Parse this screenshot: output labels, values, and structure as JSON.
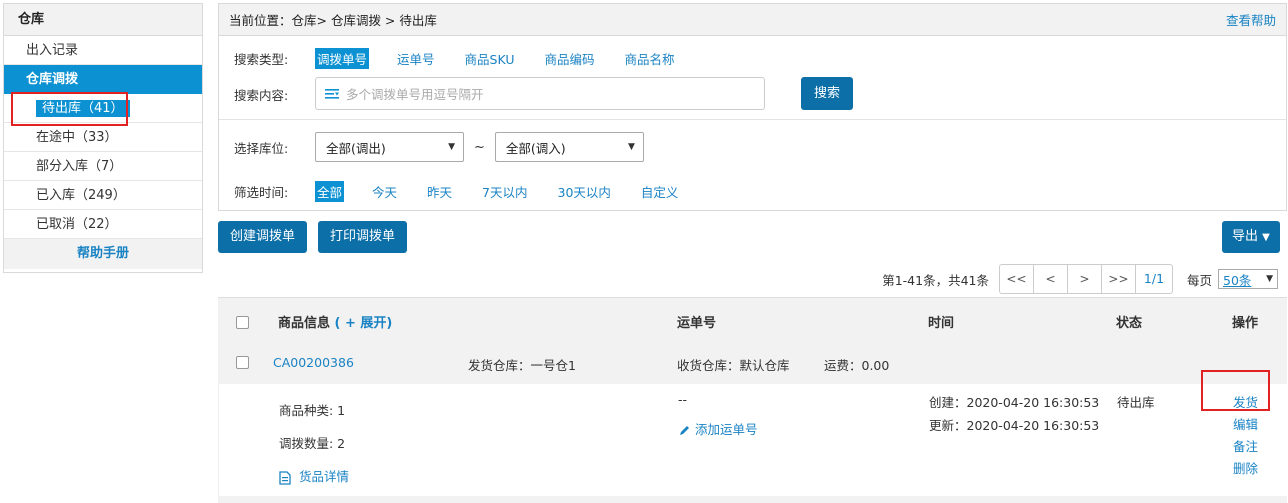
{
  "sidebar": {
    "title": "仓库",
    "items": [
      {
        "label": "出入记录"
      }
    ],
    "section": "仓库调拨",
    "subitems": [
      {
        "label": "待出库（41）",
        "active": true
      },
      {
        "label": "在途中（33）"
      },
      {
        "label": "部分入库（7）"
      },
      {
        "label": "已入库（249）"
      },
      {
        "label": "已取消（22）"
      }
    ],
    "help": "帮助手册"
  },
  "header": {
    "breadcrumb": "当前位置：仓库> 仓库调拨 > 待出库",
    "help_link": "查看帮助"
  },
  "search": {
    "type_label": "搜索类型:",
    "types": [
      "调拨单号",
      "运单号",
      "商品SKU",
      "商品编码",
      "商品名称"
    ],
    "content_label": "搜索内容:",
    "placeholder": "多个调拨单号用逗号隔开",
    "button": "搜索"
  },
  "filter": {
    "location_label": "选择库位:",
    "from_value": "全部(调出)",
    "tilde": "~",
    "to_value": "全部(调入)",
    "time_label": "筛选时间:",
    "times": [
      "全部",
      "今天",
      "昨天",
      "7天以内",
      "30天以内",
      "自定义"
    ]
  },
  "toolbar": {
    "create": "创建调拨单",
    "print": "打印调拨单",
    "export": "导出",
    "export_arrow": "▼"
  },
  "pager": {
    "summary": "第1-41条，共41条",
    "first": "<<",
    "prev": "<",
    "next": ">",
    "last": ">>",
    "current": "1/1",
    "per_page_label": "每页",
    "per_page_value": "50条"
  },
  "table": {
    "col_product": "商品信息",
    "expand": "( + 展开)",
    "col_waybill": "运单号",
    "col_time": "时间",
    "col_status": "状态",
    "col_action": "操作"
  },
  "order": {
    "id": "CA00200386",
    "ship_warehouse": "发货仓库：一号仓1",
    "recv_warehouse": "收货仓库：默认仓库",
    "freight": "运费：0.00",
    "kinds": "商品种类: 1",
    "qty": "调拨数量: 2",
    "detail_link": "货品详情",
    "waybill": "--",
    "add_waybill": "添加运单号",
    "created": "创建：2020-04-20 16:30:53",
    "updated": "更新：2020-04-20 16:30:53",
    "status": "待出库",
    "actions": [
      "发货",
      "编辑",
      "备注",
      "删除"
    ]
  },
  "colors": {
    "accent": "#0c91d2",
    "button": "#0c6fa8",
    "link": "#1a83c4",
    "highlight": "#e02222"
  }
}
